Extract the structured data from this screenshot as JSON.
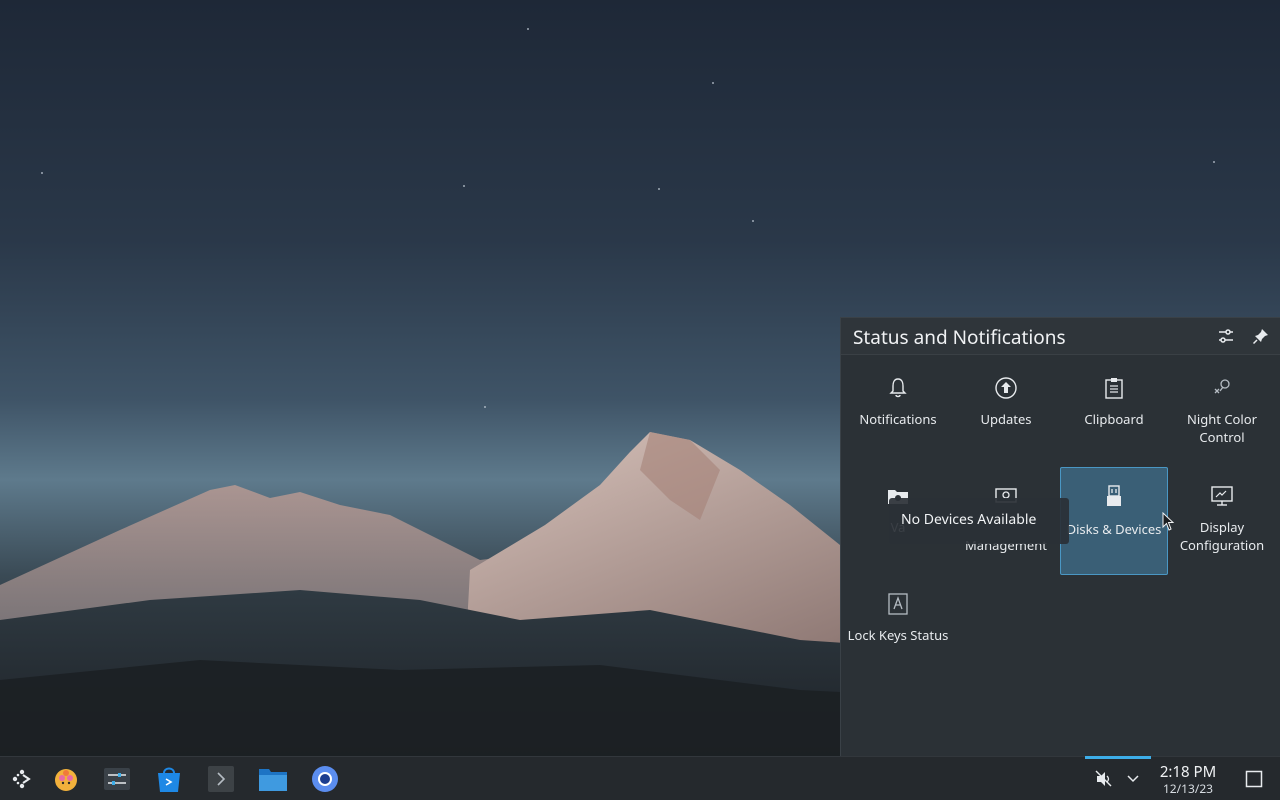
{
  "popup": {
    "title": "Status and Notifications",
    "items": [
      {
        "label": "Notifications",
        "icon": "bell-icon"
      },
      {
        "label": "Updates",
        "icon": "update-icon"
      },
      {
        "label": "Clipboard",
        "icon": "clipboard-icon"
      },
      {
        "label": "Night Color Control",
        "icon": "night-color-icon"
      },
      {
        "label": "Va",
        "icon": "vault-icon"
      },
      {
        "label": "Management",
        "icon": "power-management-icon"
      },
      {
        "label": "Disks & Devices",
        "icon": "usb-drive-icon"
      },
      {
        "label": "Display Configuration",
        "icon": "display-icon"
      },
      {
        "label": "Lock Keys Status",
        "icon": "lock-keys-icon"
      }
    ]
  },
  "tooltip": {
    "text": "No Devices Available"
  },
  "taskbar": {
    "time": "2:18 PM",
    "date": "12/13/23"
  },
  "colors": {
    "accent": "#3daee9",
    "panel_bg": "#2b3136",
    "taskbar_bg": "#25292d"
  }
}
